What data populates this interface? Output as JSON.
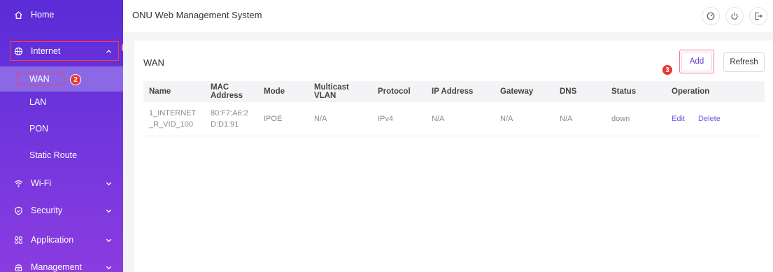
{
  "app": {
    "title": "ONU Web Management System"
  },
  "sidebar": {
    "items": [
      {
        "label": "Home",
        "icon": "home-icon"
      },
      {
        "label": "Internet",
        "icon": "globe-icon",
        "expanded": true
      },
      {
        "label": "Wi-Fi",
        "icon": "wifi-icon"
      },
      {
        "label": "Security",
        "icon": "shield-icon"
      },
      {
        "label": "Application",
        "icon": "apps-icon"
      },
      {
        "label": "Management",
        "icon": "management-icon"
      }
    ],
    "sub_items": [
      {
        "label": "WAN",
        "active": true
      },
      {
        "label": "LAN"
      },
      {
        "label": "PON"
      },
      {
        "label": "Static Route"
      }
    ]
  },
  "badges": {
    "one": "1",
    "two": "2",
    "three": "3"
  },
  "header_icons": [
    "dashboard-icon",
    "power-icon",
    "logout-icon"
  ],
  "main": {
    "section_title": "WAN",
    "add_label": "Add",
    "refresh_label": "Refresh",
    "table": {
      "columns": [
        "Name",
        "MAC Address",
        "Mode",
        "Multicast VLAN",
        "Protocol",
        "IP Address",
        "Gateway",
        "DNS",
        "Status",
        "Operation"
      ],
      "rows": [
        {
          "name": "1_INTERNET_R_VID_100",
          "mac": "80:F7:A6:2D:D1:91",
          "mode": "IPOE",
          "multicast_vlan": "N/A",
          "protocol": "IPv4",
          "ip": "N/A",
          "gateway": "N/A",
          "dns": "N/A",
          "status": "down",
          "edit": "Edit",
          "delete": "Delete"
        }
      ]
    }
  },
  "colors": {
    "sidebar_top": "#5a2bd6",
    "sidebar_bottom": "#8a3ce0",
    "accent": "#7a55e0",
    "highlight": "#ff3b3b"
  }
}
